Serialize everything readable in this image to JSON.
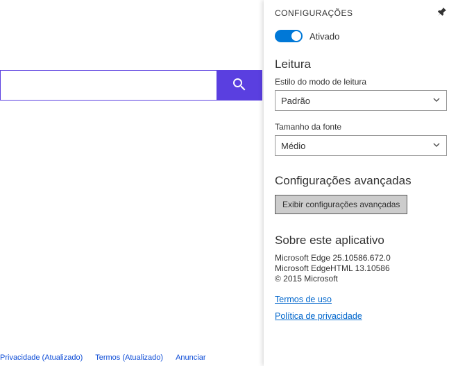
{
  "search": {
    "placeholder": ""
  },
  "footer": {
    "links": [
      "Privacidade (Atualizado)",
      "Termos (Atualizado)",
      "Anunciar"
    ]
  },
  "panel": {
    "title": "CONFIGURAÇÕES",
    "toggle_label": "Ativado",
    "reading": {
      "heading": "Leitura",
      "style_label": "Estilo do modo de leitura",
      "style_value": "Padrão",
      "font_label": "Tamanho da fonte",
      "font_value": "Médio"
    },
    "advanced": {
      "heading": "Configurações avançadas",
      "button": "Exibir configurações avançadas"
    },
    "about": {
      "heading": "Sobre este aplicativo",
      "line1": "Microsoft Edge 25.10586.672.0",
      "line2": "Microsoft EdgeHTML 13.10586",
      "line3": "© 2015 Microsoft",
      "terms": "Termos de uso",
      "privacy": "Política de privacidade"
    }
  }
}
